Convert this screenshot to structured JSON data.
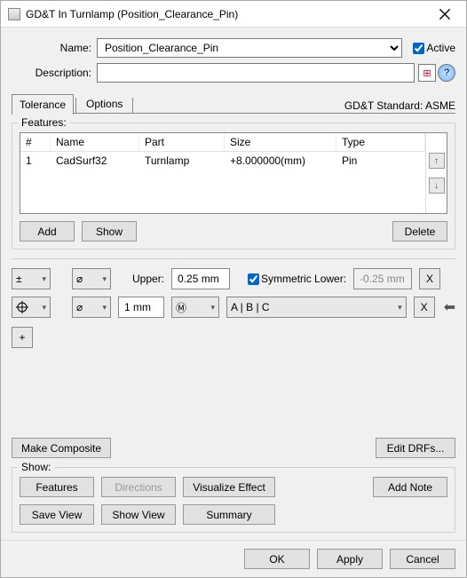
{
  "window": {
    "title": "GD&T In Turnlamp (Position_Clearance_Pin)"
  },
  "form": {
    "name_label": "Name:",
    "name_value": "Position_Clearance_Pin",
    "active_label": "Active",
    "desc_label": "Description:",
    "desc_value": ""
  },
  "tabs": {
    "tolerance": "Tolerance",
    "options": "Options"
  },
  "std_label": "GD&T Standard: ASME",
  "features": {
    "legend": "Features:",
    "headers": {
      "num": "#",
      "name": "Name",
      "part": "Part",
      "size": "Size",
      "type": "Type"
    },
    "rows": [
      {
        "num": "1",
        "name": "CadSurf32",
        "part": "Turnlamp",
        "size": "+8.000000(mm)",
        "type": "Pin"
      }
    ],
    "add": "Add",
    "show": "Show",
    "delete": "Delete"
  },
  "tol": {
    "upper_label": "Upper:",
    "upper_value": "0.25 mm",
    "sym_label": "Symmetric Lower:",
    "lower_value": "-0.25 mm",
    "size_value": "1 mm",
    "datums": "A | B | C",
    "make_composite": "Make Composite",
    "edit_drfs": "Edit DRFs..."
  },
  "show": {
    "legend": "Show:",
    "features": "Features",
    "directions": "Directions",
    "visualize": "Visualize Effect",
    "addnote": "Add Note",
    "saveview": "Save View",
    "showview": "Show View",
    "summary": "Summary"
  },
  "footer": {
    "ok": "OK",
    "apply": "Apply",
    "cancel": "Cancel"
  }
}
